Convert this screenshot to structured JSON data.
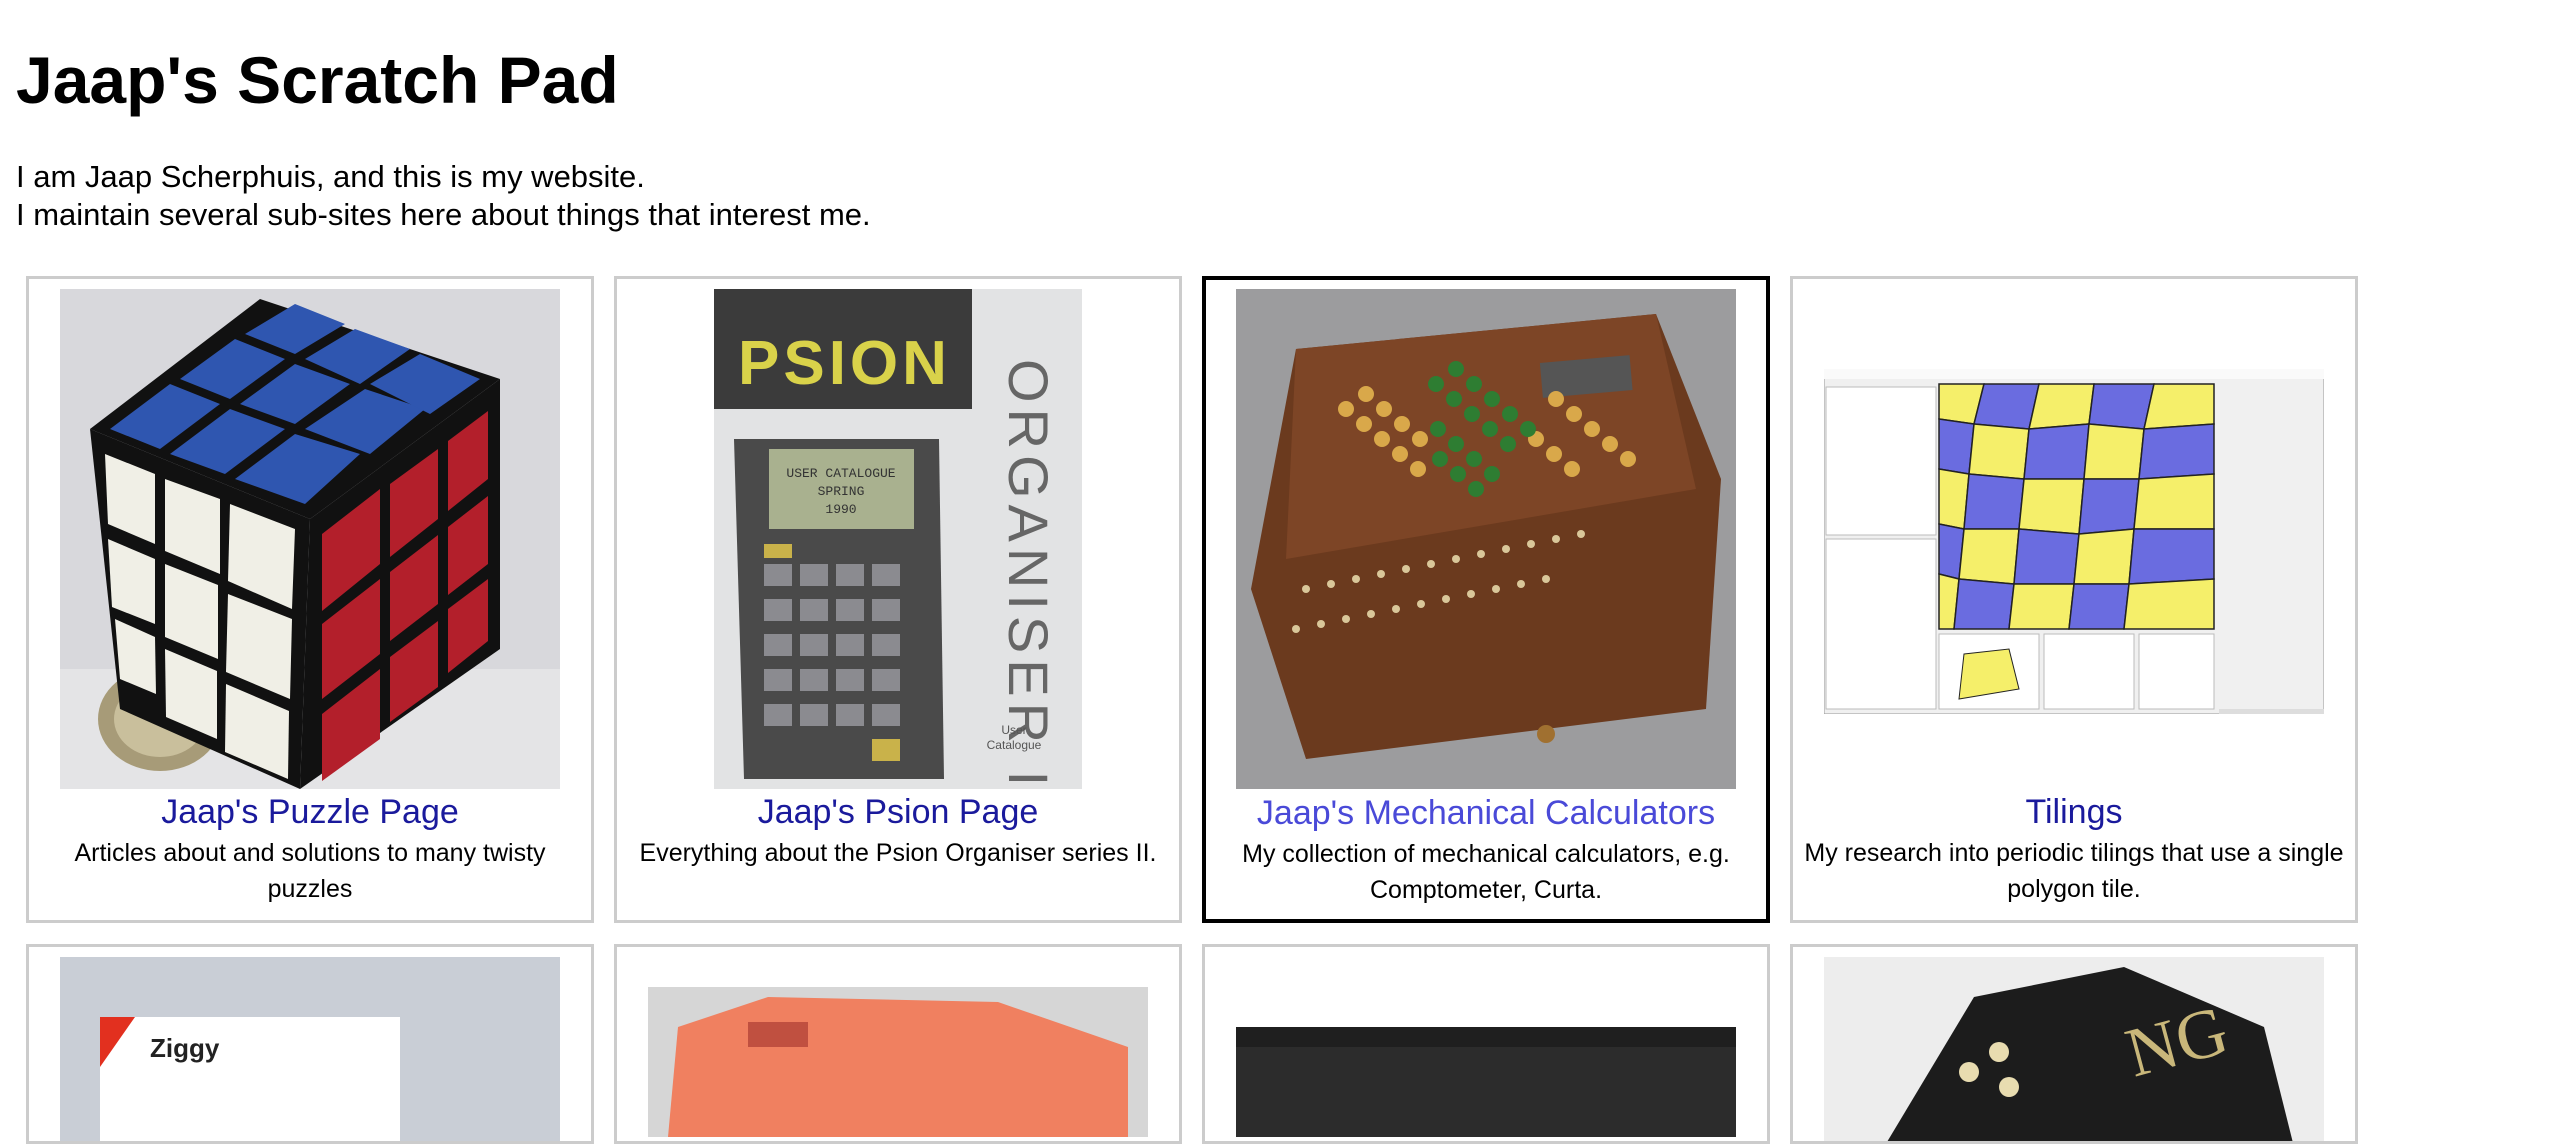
{
  "header": {
    "title": "Jaap's Scratch Pad"
  },
  "intro": {
    "line1": "I am Jaap Scherphuis, and this is my website.",
    "line2": "I maintain several sub-sites here about things that interest me."
  },
  "cards": [
    {
      "title": "Jaap's Puzzle Page",
      "description": "Articles about and solutions to many twisty puzzles",
      "image": "rubiks-cube-photo"
    },
    {
      "title": "Jaap's Psion Page",
      "description": "Everything about the Psion Organiser series II.",
      "image": "psion-organiser-catalogue-photo",
      "image_text": {
        "brand": "PSION",
        "vertical": "ORGANISER II",
        "screen_line1": "USER CATALOGUE",
        "screen_line2": "SPRING",
        "screen_line3": "1990",
        "corner_line1": "User",
        "corner_line2": "Catalogue"
      }
    },
    {
      "title": "Jaap's Mechanical Calculators",
      "description": "My collection of mechanical calculators, e.g. Comptometer, Curta.",
      "image": "mechanical-calculator-photo",
      "active": true
    },
    {
      "title": "Tilings",
      "description": "My research into periodic tilings that use a single polygon tile.",
      "image": "tilings-app-screenshot"
    }
  ],
  "cards_row2": [
    {
      "image": "ziggy-package-photo",
      "image_text": "Ziggy"
    },
    {
      "image": "orange-device-photo"
    },
    {
      "image": "dark-panel-photo"
    },
    {
      "image": "engraved-die-photo",
      "image_text": "NG"
    }
  ],
  "colors": {
    "link": "#1a1a9c",
    "link_hover": "#4a4ad8",
    "card_border": "#cccccc",
    "active_border": "#000000"
  }
}
